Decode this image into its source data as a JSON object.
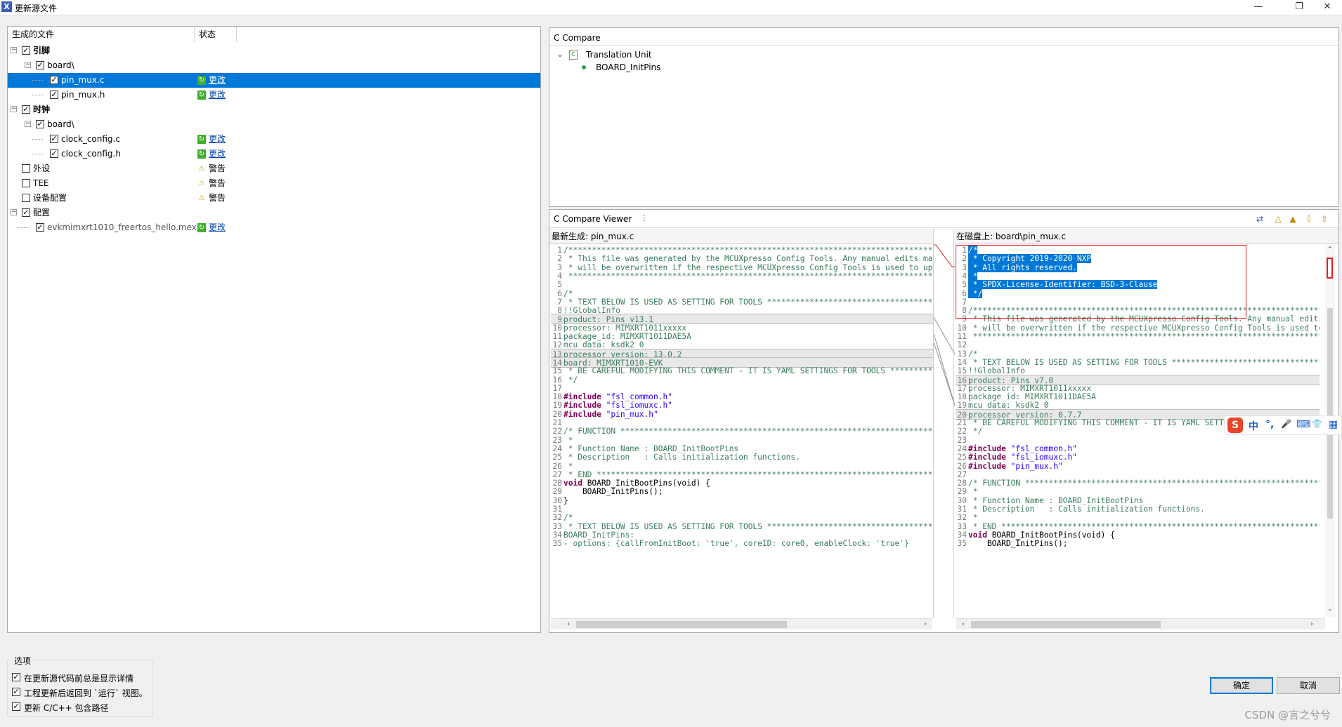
{
  "window": {
    "title": "更新源文件",
    "app_icon": "X",
    "min": "—",
    "restore": "❐",
    "close": "✕"
  },
  "tree": {
    "col_file": "生成的文件",
    "col_status": "状态",
    "rows": [
      {
        "label": "引脚",
        "bold": true,
        "checked": true,
        "status": "",
        "status_type": "none"
      },
      {
        "label": "board\\",
        "bold": false,
        "checked": true,
        "status": "",
        "status_type": "none"
      },
      {
        "label": "pin_mux.c",
        "bold": false,
        "checked": true,
        "status": "更改",
        "status_type": "change"
      },
      {
        "label": "pin_mux.h",
        "bold": false,
        "checked": true,
        "status": "更改",
        "status_type": "change"
      },
      {
        "label": "时钟",
        "bold": true,
        "checked": true,
        "status": "",
        "status_type": "none"
      },
      {
        "label": "board\\",
        "bold": false,
        "checked": true,
        "status": "",
        "status_type": "none"
      },
      {
        "label": "clock_config.c",
        "bold": false,
        "checked": true,
        "status": "更改",
        "status_type": "change"
      },
      {
        "label": "clock_config.h",
        "bold": false,
        "checked": true,
        "status": "更改",
        "status_type": "change"
      },
      {
        "label": "外设",
        "bold": false,
        "checked": false,
        "status": "警告",
        "status_type": "warn"
      },
      {
        "label": "TEE",
        "bold": false,
        "checked": false,
        "status": "警告",
        "status_type": "warn"
      },
      {
        "label": "设备配置",
        "bold": false,
        "checked": false,
        "status": "警告",
        "status_type": "warn"
      },
      {
        "label": "配置",
        "bold": false,
        "checked": true,
        "status": "",
        "status_type": "none"
      },
      {
        "label": "evkmimxrt1010_freertos_hello.mex",
        "bold": false,
        "checked": true,
        "status": "更改",
        "status_type": "change"
      }
    ]
  },
  "compare": {
    "title": "C Compare",
    "node_tu": "Translation Unit",
    "node_fn": "BOARD_InitPins"
  },
  "viewer": {
    "title": "C Compare Viewer",
    "left_header": "最新生成:  pin_mux.c",
    "right_header": "在磁盘上:  board\\pin_mux.c",
    "left_lines": [
      "/*****************************************************************************************************",
      " * This file was generated by the MCUXpresso Config Tools. Any manual edits made to this file",
      " * will be overwritten if the respective MCUXpresso Config Tools is used to update this file.",
      " *****************************************************************************************************/",
      "",
      "/*",
      " * TEXT BELOW IS USED AS SETTING FOR TOOLS *************************************",
      "!!GlobalInfo",
      "product: Pins v13.1",
      "processor: MIMXRT1011xxxxx",
      "package_id: MIMXRT1011DAE5A",
      "mcu_data: ksdk2_0",
      "processor_version: 13.0.2",
      "board: MIMXRT1010-EVK",
      " * BE CAREFUL MODIFYING THIS COMMENT - IT IS YAML SETTINGS FOR TOOLS ***********",
      " */",
      "",
      "#include \"fsl_common.h\"",
      "#include \"fsl_iomuxc.h\"",
      "#include \"pin_mux.h\"",
      "",
      "/* FUNCTION *************************************************************************",
      " *",
      " * Function Name : BOARD_InitBootPins",
      " * Description   : Calls initialization functions.",
      " *",
      " * END ******************************************************************************/",
      "void BOARD_InitBootPins(void) {",
      "    BOARD_InitPins();",
      "}",
      "",
      "/*",
      " * TEXT BELOW IS USED AS SETTING FOR TOOLS *************************************",
      "BOARD_InitPins:",
      "- options: {callFromInitBoot: 'true', coreID: core0, enableClock: 'true'}"
    ],
    "right_lines": [
      "/*",
      " * Copyright 2019-2020 NXP",
      " * All rights reserved.",
      " *",
      " * SPDX-License-Identifier: BSD-3-Clause",
      " */",
      "",
      "/*****************************************************************************************************",
      " * This file was generated by the MCUXpresso Config Tools. Any manual edits made to this file",
      " * will be overwritten if the respective MCUXpresso Config Tools is used to update this file.",
      " *****************************************************************************************************/",
      "",
      "/*",
      " * TEXT BELOW IS USED AS SETTING FOR TOOLS *************************************",
      "!!GlobalInfo",
      "product: Pins v7.0",
      "processor: MIMXRT1011xxxxx",
      "package_id: MIMXRT1011DAE5A",
      "mcu_data: ksdk2_0",
      "processor_version: 0.7.7",
      " * BE CAREFUL MODIFYING THIS COMMENT - IT IS YAML SETTINGS FOR TOOLS ***********",
      " */",
      "",
      "#include \"fsl_common.h\"",
      "#include \"fsl_iomuxc.h\"",
      "#include \"pin_mux.h\"",
      "",
      "/* FUNCTION *************************************************************************",
      " *",
      " * Function Name : BOARD_InitBootPins",
      " * Description   : Calls initialization functions.",
      " *",
      " * END ******************************************************************************/",
      "void BOARD_InitBootPins(void) {",
      "    BOARD_InitPins();"
    ]
  },
  "options": {
    "label": "选项",
    "items": [
      "在更新源代码前总是显示详情",
      "工程更新后返回到 `运行` 视图。",
      "更新 C/C++ 包含路径"
    ]
  },
  "buttons": {
    "ok": "确定",
    "cancel": "取消"
  },
  "watermark": "CSDN @言之兮兮",
  "ime": {
    "cn": "中",
    "punct": "°,",
    "mic": "🎤",
    "kbd": "⌨",
    "shirt": "👕",
    "grid": "▦",
    "logo": "S"
  },
  "colors": {
    "selection": "#0078d7",
    "change_icon": "#3fae2a",
    "warn_icon": "#e0a000",
    "diff_marker": "#e02020"
  }
}
